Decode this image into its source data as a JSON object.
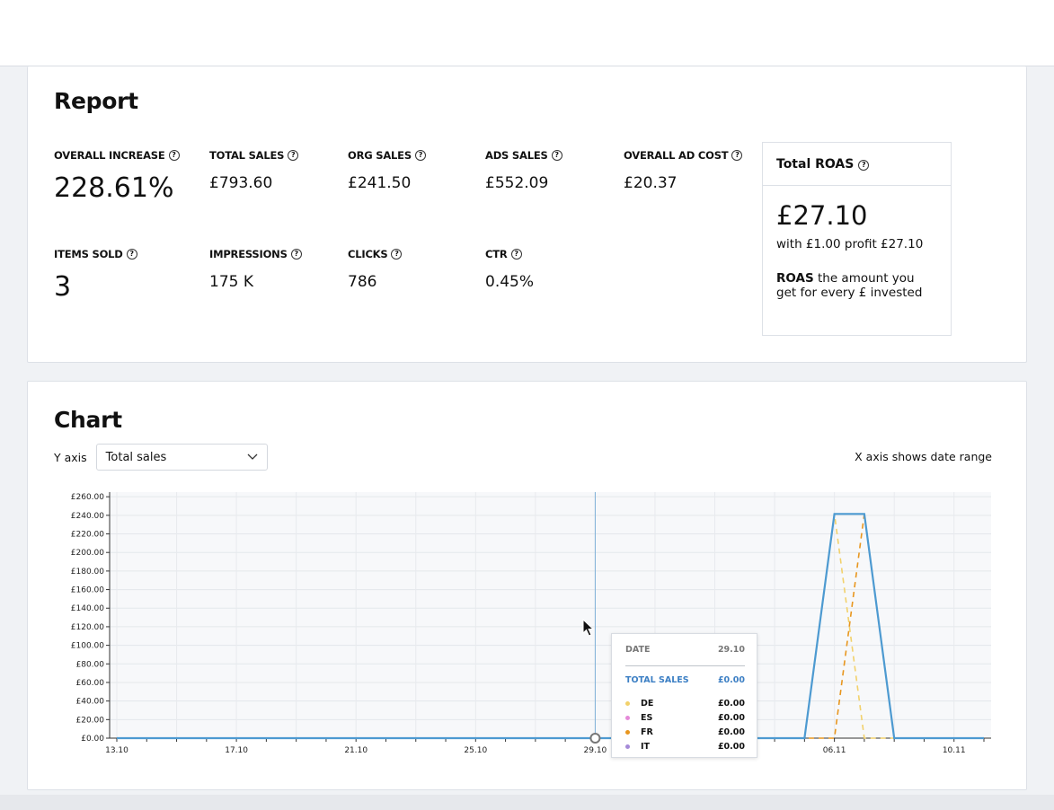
{
  "report": {
    "title": "Report",
    "metrics": [
      {
        "label": "OVERALL INCREASE",
        "value": "228.61%"
      },
      {
        "label": "TOTAL SALES",
        "value": "£793.60"
      },
      {
        "label": "ORG SALES",
        "value": "£241.50"
      },
      {
        "label": "ADS SALES",
        "value": "£552.09"
      },
      {
        "label": "OVERALL AD COST",
        "value": "£20.37"
      },
      {
        "label": "ITEMS SOLD",
        "value": "3"
      },
      {
        "label": "IMPRESSIONS",
        "value": "175 K"
      },
      {
        "label": "CLICKS",
        "value": "786"
      },
      {
        "label": "CTR",
        "value": "0.45%"
      }
    ],
    "roas": {
      "title": "Total ROAS",
      "value": "£27.10",
      "profit": "with £1.00 profit £27.10",
      "desc_bold": "ROAS",
      "desc_rest": " the amount you get for every £ invested"
    }
  },
  "chart_section": {
    "title": "Chart",
    "y_axis_label": "Y axis",
    "y_axis_selected": "Total sales",
    "x_axis_note": "X axis shows date range"
  },
  "tooltip": {
    "date_label": "DATE",
    "date_value": "29.10",
    "total_label": "TOTAL SALES",
    "total_value": "£0.00",
    "series": [
      {
        "name": "DE",
        "value": "£0.00",
        "color": "#f2d16b"
      },
      {
        "name": "ES",
        "value": "£0.00",
        "color": "#e58ad9"
      },
      {
        "name": "FR",
        "value": "£0.00",
        "color": "#e8961e"
      },
      {
        "name": "IT",
        "value": "£0.00",
        "color": "#a58ad8"
      }
    ]
  },
  "chart_data": {
    "type": "line",
    "x": [
      "13.10",
      "14.10",
      "15.10",
      "16.10",
      "17.10",
      "18.10",
      "19.10",
      "20.10",
      "21.10",
      "22.10",
      "23.10",
      "24.10",
      "25.10",
      "26.10",
      "27.10",
      "28.10",
      "29.10",
      "30.10",
      "31.10",
      "01.11",
      "02.11",
      "03.11",
      "04.11",
      "05.11",
      "06.11",
      "07.11",
      "08.11",
      "09.11",
      "10.11",
      "11.11"
    ],
    "x_tick_labels": [
      "13.10",
      "17.10",
      "21.10",
      "25.10",
      "29.10",
      "06.11",
      "10.11"
    ],
    "y_tick_labels": [
      "£0.00",
      "£20.00",
      "£40.00",
      "£60.00",
      "£80.00",
      "£100.00",
      "£120.00",
      "£140.00",
      "£160.00",
      "£180.00",
      "£200.00",
      "£220.00",
      "£240.00",
      "£260.00"
    ],
    "ylim": [
      0,
      265
    ],
    "series": [
      {
        "name": "Total sales",
        "color": "#4d9ad1",
        "style": "solid",
        "values": [
          0,
          0,
          0,
          0,
          0,
          0,
          0,
          0,
          0,
          0,
          0,
          0,
          0,
          0,
          0,
          0,
          0,
          0,
          0,
          0,
          0,
          0,
          0,
          0,
          241.5,
          241.5,
          0,
          0,
          0,
          0
        ]
      },
      {
        "name": "DE",
        "color": "#f2d16b",
        "style": "dashed",
        "values": [
          0,
          0,
          0,
          0,
          0,
          0,
          0,
          0,
          0,
          0,
          0,
          0,
          0,
          0,
          0,
          0,
          0,
          0,
          0,
          0,
          0,
          0,
          0,
          0,
          241.5,
          0,
          0,
          0,
          0,
          0
        ]
      },
      {
        "name": "FR",
        "color": "#e8961e",
        "style": "dashed",
        "values": [
          0,
          0,
          0,
          0,
          0,
          0,
          0,
          0,
          0,
          0,
          0,
          0,
          0,
          0,
          0,
          0,
          0,
          0,
          0,
          0,
          0,
          0,
          0,
          0,
          0,
          241.5,
          0,
          0,
          0,
          0
        ]
      }
    ],
    "hover_x": "29.10",
    "grid": true
  }
}
